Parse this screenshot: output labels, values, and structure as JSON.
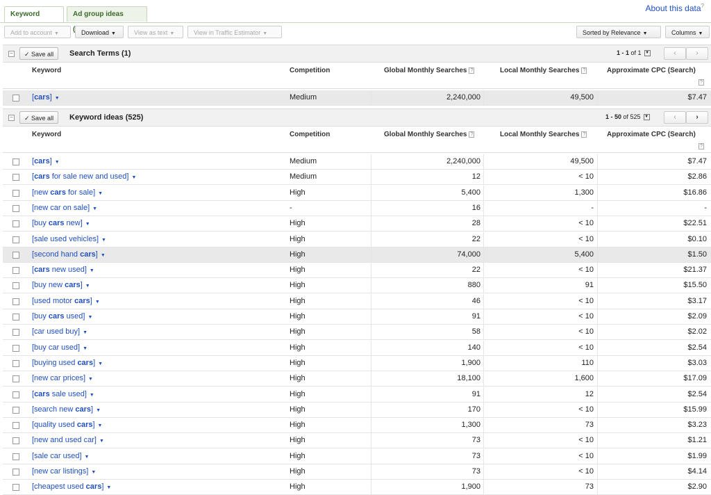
{
  "tabs": [
    {
      "label": "Keyword ideas"
    },
    {
      "label": "Ad group ideas (Beta)"
    }
  ],
  "about": "About this data",
  "toolbar": {
    "add": "Add to account",
    "download": "Download",
    "view_text": "View as text",
    "traffic": "View in Traffic Estimator",
    "sorted": "Sorted by Relevance",
    "columns": "Columns"
  },
  "search_terms": {
    "save": "Save all",
    "title": "Search Terms (1)",
    "pager_range": "1 - 1",
    "pager_of": "of 1"
  },
  "keyword_ideas": {
    "save": "Save all",
    "title": "Keyword ideas (525)",
    "pager_range": "1 - 50",
    "pager_of": "of 525"
  },
  "columns": {
    "keyword": "Keyword",
    "competition": "Competition",
    "global": "Global Monthly Searches",
    "local": "Local Monthly Searches",
    "cpc": "Approximate CPC (Search)"
  },
  "search_rows": [
    {
      "pre": "[",
      "bold": "",
      "kw": "cars",
      "post": "]",
      "competition": "Medium",
      "global": "2,240,000",
      "local": "49,500",
      "cpc": "$7.47"
    }
  ],
  "idea_rows": [
    {
      "kw": "[cars]",
      "competition": "Medium",
      "global": "2,240,000",
      "local": "49,500",
      "cpc": "$7.47"
    },
    {
      "kw": "[cars for sale new and used]",
      "competition": "Medium",
      "global": "12",
      "local": "< 10",
      "cpc": "$2.86"
    },
    {
      "kw": "[new cars for sale]",
      "competition": "High",
      "global": "5,400",
      "local": "1,300",
      "cpc": "$16.86"
    },
    {
      "kw": "[new car on sale]",
      "competition": "-",
      "global": "16",
      "local": "-",
      "cpc": "-"
    },
    {
      "kw": "[buy cars new]",
      "competition": "High",
      "global": "28",
      "local": "< 10",
      "cpc": "$22.51"
    },
    {
      "kw": "[sale used vehicles]",
      "competition": "High",
      "global": "22",
      "local": "< 10",
      "cpc": "$0.10"
    },
    {
      "kw": "[second hand cars]",
      "competition": "High",
      "global": "74,000",
      "local": "5,400",
      "cpc": "$1.50"
    },
    {
      "kw": "[cars new used]",
      "competition": "High",
      "global": "22",
      "local": "< 10",
      "cpc": "$21.37"
    },
    {
      "kw": "[buy new cars]",
      "competition": "High",
      "global": "880",
      "local": "91",
      "cpc": "$15.50"
    },
    {
      "kw": "[used motor cars]",
      "competition": "High",
      "global": "46",
      "local": "< 10",
      "cpc": "$3.17"
    },
    {
      "kw": "[buy cars used]",
      "competition": "High",
      "global": "91",
      "local": "< 10",
      "cpc": "$2.09"
    },
    {
      "kw": "[car used buy]",
      "competition": "High",
      "global": "58",
      "local": "< 10",
      "cpc": "$2.02"
    },
    {
      "kw": "[buy car used]",
      "competition": "High",
      "global": "140",
      "local": "< 10",
      "cpc": "$2.54"
    },
    {
      "kw": "[buying used cars]",
      "competition": "High",
      "global": "1,900",
      "local": "110",
      "cpc": "$3.03"
    },
    {
      "kw": "[new car prices]",
      "competition": "High",
      "global": "18,100",
      "local": "1,600",
      "cpc": "$17.09"
    },
    {
      "kw": "[cars sale used]",
      "competition": "High",
      "global": "91",
      "local": "12",
      "cpc": "$2.54"
    },
    {
      "kw": "[search new cars]",
      "competition": "High",
      "global": "170",
      "local": "< 10",
      "cpc": "$15.99"
    },
    {
      "kw": "[quality used cars]",
      "competition": "High",
      "global": "1,300",
      "local": "73",
      "cpc": "$3.23"
    },
    {
      "kw": "[new and used car]",
      "competition": "High",
      "global": "73",
      "local": "< 10",
      "cpc": "$1.21"
    },
    {
      "kw": "[sale car used]",
      "competition": "High",
      "global": "73",
      "local": "< 10",
      "cpc": "$1.99"
    },
    {
      "kw": "[new car listings]",
      "competition": "High",
      "global": "73",
      "local": "< 10",
      "cpc": "$4.14"
    },
    {
      "kw": "[cheapest used cars]",
      "competition": "High",
      "global": "1,900",
      "local": "73",
      "cpc": "$2.90"
    }
  ]
}
